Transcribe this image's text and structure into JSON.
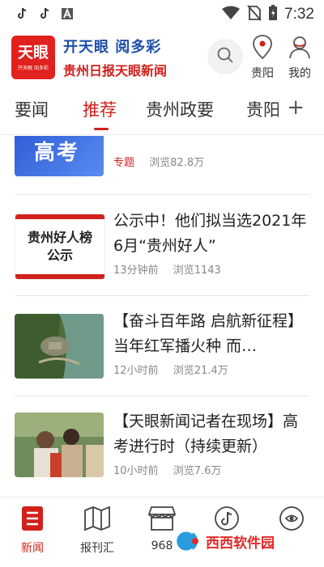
{
  "status_bar": {
    "time": "7:32"
  },
  "header": {
    "logo_big": "天眼",
    "logo_small": "开天眼 阅多彩",
    "slogan_line1": "开天眼 阅多彩",
    "slogan_line2": "贵州日报天眼新闻",
    "location_label": "贵阳",
    "profile_label": "我的"
  },
  "tabs": [
    {
      "label": "要闻",
      "active": false
    },
    {
      "label": "推荐",
      "active": true
    },
    {
      "label": "贵州政要",
      "active": false
    },
    {
      "label": "贵阳",
      "active": false
    }
  ],
  "feed": [
    {
      "thumb_text": "高考",
      "title": "",
      "tag": "专题",
      "time": "",
      "views": "浏览82.8万"
    },
    {
      "thumb_text": "贵州好人榜\n公示",
      "title": "公示中！他们拟当选2021年6月“贵州好人”",
      "tag": "",
      "time": "13分钟前",
      "views": "浏览1143"
    },
    {
      "thumb_text": "",
      "title": "【奋斗百年路 启航新征程】当年红军播火种 而…",
      "tag": "",
      "time": "12小时前",
      "views": "浏览21.4万"
    },
    {
      "thumb_text": "",
      "title": "【天眼新闻记者在现场】高考进行时（持续更新）",
      "tag": "",
      "time": "10小时前",
      "views": "浏览7.6万"
    }
  ],
  "bottom_nav": [
    {
      "label": "新闻",
      "icon": "news-icon",
      "active": true
    },
    {
      "label": "报刊汇",
      "icon": "map-icon",
      "active": false
    },
    {
      "label": "968",
      "icon": "store-icon",
      "active": false
    },
    {
      "label": "",
      "icon": "music-icon",
      "active": false
    },
    {
      "label": "",
      "icon": "tianyan-icon",
      "active": false
    }
  ],
  "watermark": {
    "text": "西西软件园"
  },
  "colors": {
    "brand_red": "#d0211b",
    "brand_blue": "#1e4ea8",
    "meta_gray": "#888888"
  }
}
